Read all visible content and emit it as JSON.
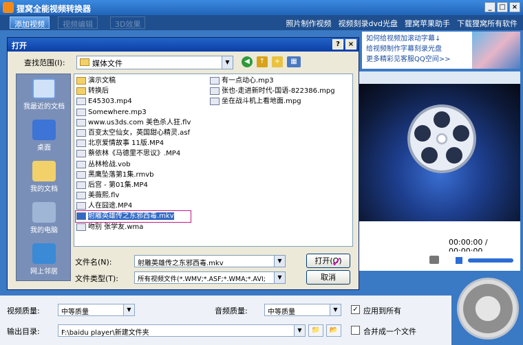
{
  "app": {
    "title": "狸窝全能视频转换器",
    "window_buttons": [
      "_",
      "□",
      "×"
    ],
    "toolbar": {
      "add_video": "添加视频",
      "edit_video": "视频编辑",
      "effects_3d": "3D效果"
    },
    "top_links": [
      "照片制作视频",
      "视频刻录dvd光盘",
      "狸窝苹果助手",
      "下载狸窝所有软件"
    ],
    "promo_links": [
      "如何给视频加滚动字幕↓",
      "给视频制作字幕刻录光盘",
      "更多精彩见客服QQ空间>>"
    ],
    "preview": {
      "time": "00:00:00 / 00:00:00"
    },
    "bottom": {
      "video_quality_label": "视频质量:",
      "video_quality_value": "中等质量",
      "audio_quality_label": "音频质量:",
      "audio_quality_value": "中等质量",
      "apply_all": "应用到所有",
      "output_label": "输出目录:",
      "output_value": "F:\\baidu player\\新建文件夹",
      "merge": "合并成一个文件"
    }
  },
  "dialog": {
    "title": "打开",
    "title_buttons": [
      "?",
      "×"
    ],
    "look_in_label": "查找范围(I):",
    "look_in_value": "媒体文件",
    "places": [
      "我最近的文档",
      "桌面",
      "我的文档",
      "我的电脑",
      "网上邻居"
    ],
    "files_col1": [
      {
        "name": "演示文稿",
        "kind": "folder"
      },
      {
        "name": "转换后",
        "kind": "folder"
      },
      {
        "name": "E45303.mp4",
        "kind": "media"
      },
      {
        "name": "Somewhere.mp3",
        "kind": "media"
      },
      {
        "name": "www.us3ds.com 美色杀人狂.flv",
        "kind": "media"
      },
      {
        "name": "百变太空仙女，英国甜心精灵.asf",
        "kind": "media"
      },
      {
        "name": "北京爱情故事 11版.MP4",
        "kind": "media"
      },
      {
        "name": "蔡依林《马德里不思议》.MP4",
        "kind": "media"
      },
      {
        "name": "丛林枪战.vob",
        "kind": "media"
      },
      {
        "name": "黑鹰坠落第1集.rmvb",
        "kind": "media"
      },
      {
        "name": "后宫 - 第01集.MP4",
        "kind": "media"
      },
      {
        "name": "美薇熙.flv",
        "kind": "media"
      },
      {
        "name": "人在囧途.MP4",
        "kind": "media"
      },
      {
        "name": "射雕英雄传之东邪西毒.mkv",
        "kind": "media",
        "selected": true
      },
      {
        "name": "吻别 张学友.wma",
        "kind": "media"
      }
    ],
    "files_col2": [
      {
        "name": "有一点动心.mp3",
        "kind": "media"
      },
      {
        "name": "张也-走进新时代-国语-822386.mpg",
        "kind": "media"
      },
      {
        "name": "坐在战斗机上看地面.mpg",
        "kind": "media"
      }
    ],
    "filename_label": "文件名(N):",
    "filename_value": "射雕英雄传之东邪西毒.mkv",
    "filetype_label": "文件类型(T):",
    "filetype_value": "所有视频文件(*.WMV;*.ASF;*.WMA;*.AVI;",
    "open_button": "打开(O)",
    "cancel_button": "取消"
  },
  "colors": {
    "accent": "#316ac5",
    "titlebar": "#2164b8",
    "highlight_border": "#c0187f"
  }
}
